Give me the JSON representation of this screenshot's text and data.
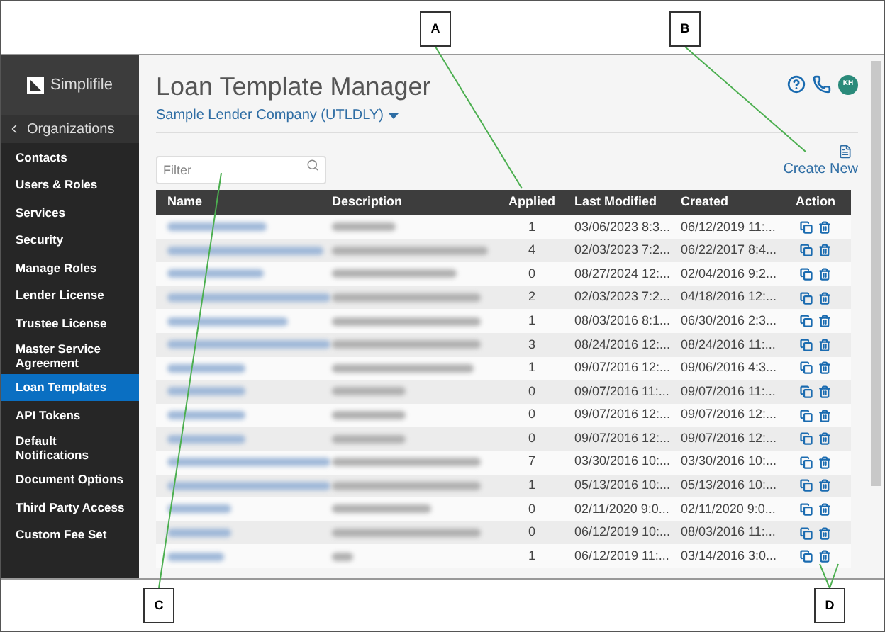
{
  "callouts": [
    {
      "label": "A"
    },
    {
      "label": "B"
    },
    {
      "label": "C"
    },
    {
      "label": "D"
    }
  ],
  "sidebar": {
    "logo": "Simplifile",
    "back": "Organizations",
    "items": [
      {
        "label": "Contacts",
        "selected": false
      },
      {
        "label": "Users & Roles",
        "selected": false
      },
      {
        "label": "Services",
        "selected": false
      },
      {
        "label": "Security",
        "selected": false
      },
      {
        "label": "Manage Roles",
        "selected": false
      },
      {
        "label": "Lender License",
        "selected": false
      },
      {
        "label": "Trustee License",
        "selected": false
      },
      {
        "label": "Master Service Agreement",
        "selected": false
      },
      {
        "label": "Loan Templates",
        "selected": true
      },
      {
        "label": "API Tokens",
        "selected": false
      },
      {
        "label": "Default Notifications",
        "selected": false
      },
      {
        "label": "Document Options",
        "selected": false
      },
      {
        "label": "Third Party Access",
        "selected": false
      },
      {
        "label": "Custom Fee Set",
        "selected": false
      }
    ]
  },
  "header": {
    "title": "Loan Template Manager",
    "company": "Sample Lender Company (UTLDLY)",
    "avatar": "KH"
  },
  "filter": {
    "placeholder": "Filter"
  },
  "create_new": "Create New",
  "table": {
    "columns": [
      "Name",
      "Description",
      "Applied",
      "Last Modified",
      "Created",
      "Action"
    ],
    "rows": [
      {
        "applied": "1",
        "last_modified": "03/06/2023 8:3...",
        "created": "06/12/2019 11:..."
      },
      {
        "applied": "4",
        "last_modified": "02/03/2023 7:2...",
        "created": "06/22/2017 8:4..."
      },
      {
        "applied": "0",
        "last_modified": "08/27/2024 12:...",
        "created": "02/04/2016 9:2..."
      },
      {
        "applied": "2",
        "last_modified": "02/03/2023 7:2...",
        "created": "04/18/2016 12:..."
      },
      {
        "applied": "1",
        "last_modified": "08/03/2016 8:1...",
        "created": "06/30/2016 2:3..."
      },
      {
        "applied": "3",
        "last_modified": "08/24/2016 12:...",
        "created": "08/24/2016 11:..."
      },
      {
        "applied": "1",
        "last_modified": "09/07/2016 12:...",
        "created": "09/06/2016 4:3..."
      },
      {
        "applied": "0",
        "last_modified": "09/07/2016 11:...",
        "created": "09/07/2016 11:..."
      },
      {
        "applied": "0",
        "last_modified": "09/07/2016 12:...",
        "created": "09/07/2016 12:..."
      },
      {
        "applied": "0",
        "last_modified": "09/07/2016 12:...",
        "created": "09/07/2016 12:..."
      },
      {
        "applied": "7",
        "last_modified": "03/30/2016 10:...",
        "created": "03/30/2016 10:..."
      },
      {
        "applied": "1",
        "last_modified": "05/13/2016 10:...",
        "created": "05/13/2016 10:..."
      },
      {
        "applied": "0",
        "last_modified": "02/11/2020 9:0...",
        "created": "02/11/2020 9:0..."
      },
      {
        "applied": "0",
        "last_modified": "06/12/2019 10:...",
        "created": "08/03/2016 11:..."
      },
      {
        "applied": "1",
        "last_modified": "06/12/2019 11:...",
        "created": "03/14/2016 3:0..."
      }
    ]
  }
}
